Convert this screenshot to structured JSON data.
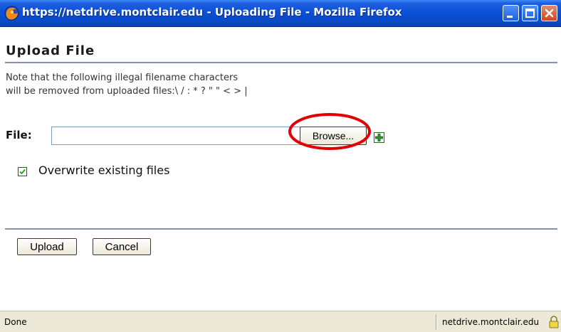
{
  "window": {
    "title": "https://netdrive.montclair.edu - Uploading File - Mozilla Firefox",
    "icon": "firefox-icon",
    "controls": [
      "minimize-icon",
      "maximize-icon",
      "close-icon"
    ]
  },
  "page": {
    "heading": "Upload File",
    "note_line1": "Note that the following illegal filename characters",
    "note_line2": "will be removed from uploaded files:\\ / : * ? \" \" < > |"
  },
  "form": {
    "file_label": "File:",
    "file_value": "",
    "browse_label": "Browse...",
    "add_icon": "plus-icon",
    "overwrite_label": "Overwrite existing files",
    "overwrite_checked": true
  },
  "actions": {
    "upload_label": "Upload",
    "cancel_label": "Cancel"
  },
  "status": {
    "left": "Done",
    "host": "netdrive.montclair.edu",
    "icon": "lock-icon"
  },
  "colors": {
    "titlebar": "#0a4fd6",
    "annotation": "#e30000",
    "rule": "#8592a8"
  }
}
